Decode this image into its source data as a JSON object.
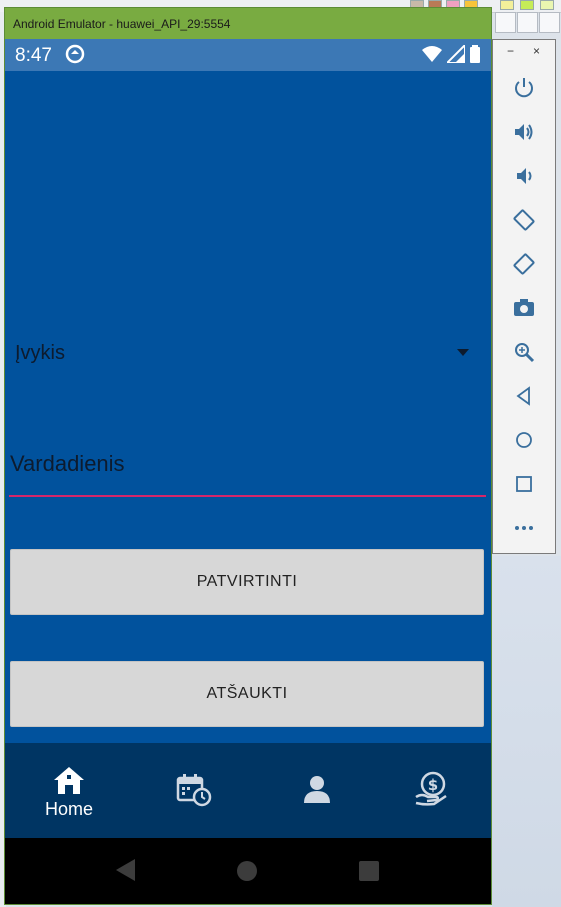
{
  "window": {
    "title": "Android Emulator - huawei_API_29:5554"
  },
  "status_bar": {
    "time": "8:47"
  },
  "form": {
    "event_dropdown": {
      "selected": "Įvykis"
    },
    "name_field": {
      "placeholder": "Vardadienis"
    },
    "confirm_label": "PATVIRTINTI",
    "cancel_label": "ATŠAUKTI"
  },
  "bottom_nav": {
    "items": [
      {
        "icon": "home-icon",
        "label": "Home",
        "active": true
      },
      {
        "icon": "calendar-clock-icon",
        "label": ""
      },
      {
        "icon": "person-icon",
        "label": ""
      },
      {
        "icon": "money-hand-icon",
        "label": ""
      }
    ]
  },
  "side_toolbar": {
    "minimize": "−",
    "close": "×",
    "tools": [
      "power-icon",
      "volume-up-icon",
      "volume-down-icon",
      "rotate-left-icon",
      "rotate-right-icon",
      "camera-icon",
      "zoom-icon",
      "back-icon",
      "home-icon",
      "overview-icon",
      "more-icon"
    ]
  },
  "colors": {
    "title_bar": "#79ab41",
    "status_bar": "#3c78b5",
    "content_bg": "#01529d",
    "bottom_nav_bg": "#003563",
    "input_underline": "#d6266a",
    "button_bg": "#d7d7d7"
  }
}
